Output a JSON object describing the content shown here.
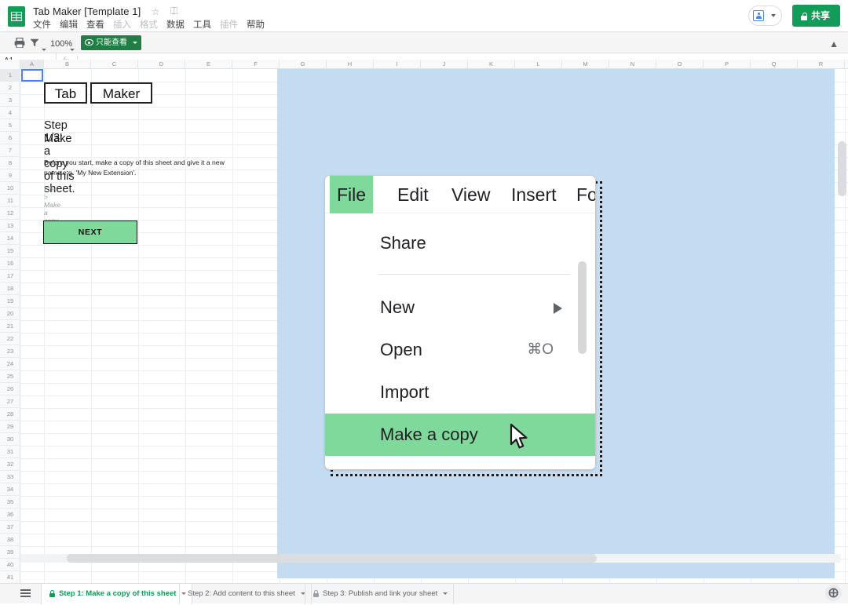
{
  "app": {
    "logo_icon": "google-sheets-icon",
    "doc_title": "Tab Maker [Template 1]",
    "star_icon": "star-icon",
    "drive_icon": "move-to-folder-icon"
  },
  "menubar": {
    "items": [
      {
        "label": "文件",
        "dim": false
      },
      {
        "label": "编辑",
        "dim": false
      },
      {
        "label": "查看",
        "dim": false
      },
      {
        "label": "插入",
        "dim": true
      },
      {
        "label": "格式",
        "dim": true
      },
      {
        "label": "数据",
        "dim": false
      },
      {
        "label": "工具",
        "dim": false
      },
      {
        "label": "插件",
        "dim": true
      },
      {
        "label": "帮助",
        "dim": false
      }
    ]
  },
  "header_right": {
    "add_person_icon": "add-person-icon",
    "share_label": "共享",
    "share_lock_icon": "lock-icon"
  },
  "toolbar": {
    "print_icon": "print-icon",
    "filter_icon": "filter-icon",
    "zoom_level": "100%",
    "view_only_label": "只能查看",
    "view_only_icon": "eye-icon",
    "collapse_icon": "chevron-up-icon"
  },
  "formula_bar": {
    "cell_ref": "A1",
    "fx_icon": "fx-icon",
    "value": ""
  },
  "grid": {
    "columns": [
      "A",
      "B",
      "C",
      "D",
      "E",
      "F",
      "G",
      "H",
      "I",
      "J",
      "K",
      "L",
      "M",
      "N",
      "O",
      "P",
      "Q",
      "R"
    ],
    "rows": [
      1,
      2,
      3,
      4,
      5,
      6,
      7,
      8,
      9,
      10,
      11,
      12,
      13,
      14,
      15,
      16,
      17,
      18,
      19,
      20,
      21,
      22,
      23,
      24,
      25,
      26,
      27,
      28,
      29,
      30,
      31,
      32,
      33,
      34,
      35,
      36,
      37,
      38,
      39,
      40,
      41
    ],
    "selected_cell": "A1",
    "background_color": "#c3dcf2"
  },
  "sheet_content": {
    "tag_left": "Tab",
    "tag_right": "Maker",
    "step_label": "Step 1/3:",
    "step_title": "Make a copy of this sheet.",
    "body_text": "Before you start, make a copy of this sheet and give it a new name e.g. 'My New Extension'.",
    "path_hint": "File > Make a copy",
    "next_button": "NEXT"
  },
  "embedded_image": {
    "menubar": [
      {
        "label": "File",
        "active": true
      },
      {
        "label": "Edit",
        "active": false
      },
      {
        "label": "View",
        "active": false
      },
      {
        "label": "Insert",
        "active": false
      },
      {
        "label": "Form",
        "active": false
      }
    ],
    "menu_items": [
      {
        "label": "Share",
        "shortcut": "",
        "submenu": false,
        "highlighted": false
      },
      {
        "label": "New",
        "shortcut": "",
        "submenu": true,
        "highlighted": false
      },
      {
        "label": "Open",
        "shortcut": "⌘O",
        "submenu": false,
        "highlighted": false
      },
      {
        "label": "Import",
        "shortcut": "",
        "submenu": false,
        "highlighted": false
      },
      {
        "label": "Make a copy",
        "shortcut": "",
        "submenu": false,
        "highlighted": true
      }
    ],
    "cursor_icon": "mouse-pointer-icon",
    "highlight_color": "#7ed99a"
  },
  "bottom_bar": {
    "all_sheets_icon": "all-sheets-icon",
    "tabs": [
      {
        "label": "Step 1: Make a copy of this sheet",
        "active": true,
        "locked": true
      },
      {
        "label": "Step 2: Add content to this sheet",
        "active": false,
        "locked": false
      },
      {
        "label": "Step 3: Publish and link your sheet",
        "active": false,
        "locked": true
      }
    ],
    "explore_icon": "explore-icon"
  },
  "colors": {
    "brand_green": "#0f9d58",
    "highlight_green": "#7ed99a",
    "sheet_blue": "#c3dcf2",
    "selection_blue": "#4285f4"
  }
}
